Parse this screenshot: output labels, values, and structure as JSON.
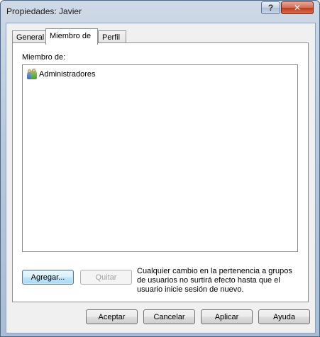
{
  "window": {
    "title": "Propiedades: Javier",
    "help_label": "?",
    "close_label": "✕"
  },
  "tabs": [
    {
      "label": "General"
    },
    {
      "label": "Miembro de",
      "active": true
    },
    {
      "label": "Perfil"
    }
  ],
  "member_panel": {
    "label": "Miembro de:",
    "items": [
      {
        "icon": "user-group-icon",
        "label": "Administradores"
      }
    ],
    "add_button": "Agregar...",
    "remove_button": "Quitar",
    "note": "Cualquier cambio en la pertenencia a grupos de usuarios no surtirá efecto hasta que el usuario inicie sesión de nuevo."
  },
  "footer": {
    "ok": "Aceptar",
    "cancel": "Cancelar",
    "apply": "Aplicar",
    "help": "Ayuda"
  },
  "colors": {
    "frame": "#b9c9dc",
    "close_button": "#c2391b",
    "focus_button": "#3c7fb1"
  }
}
